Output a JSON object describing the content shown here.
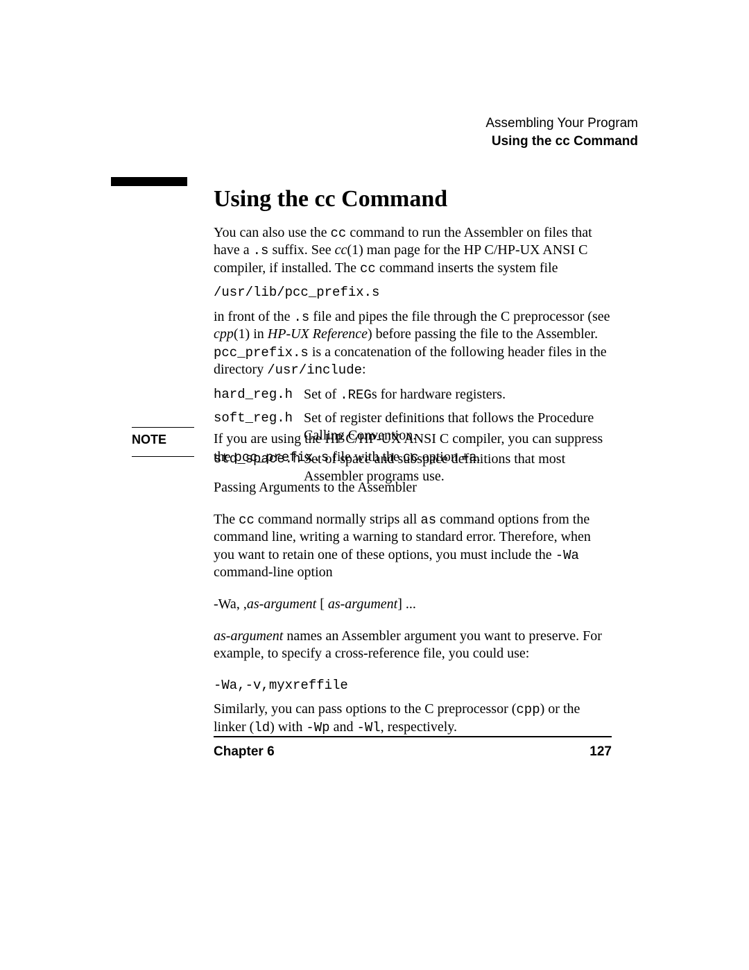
{
  "running_head": {
    "line1": "Assembling Your Program",
    "line2": "Using the cc Command"
  },
  "section": {
    "title": "Using the cc Command",
    "p1a": "You can also use the ",
    "p1b": "cc",
    "p1c": " command to run the Assembler on files that have a ",
    "p1d": ".s",
    "p1e": " suffix. See ",
    "p1f": "cc",
    "p1g": "(1) man page for the HP C/HP-UX ANSI C compiler, if installed. The ",
    "p1h": "cc",
    "p1i": " command inserts the system file",
    "codeline1": "/usr/lib/pcc_prefix.s",
    "p2a": "in front of the ",
    "p2b": ".s",
    "p2c": " file and pipes the file through the C preprocessor (see ",
    "p2d": "cpp",
    "p2e": "(1) in ",
    "p2f": "HP-UX Reference",
    "p2g": ") before passing the file to the Assembler. ",
    "p2h": "pcc_prefix.s",
    "p2i": " is a concatenation of the following header files in the directory ",
    "p2j": "/usr/include",
    "p2k": ":",
    "defs": [
      {
        "term": "hard_reg.h",
        "desc_a": "Set of ",
        "desc_b": ".REG",
        "desc_c": "s for hardware registers."
      },
      {
        "term": "soft_reg.h",
        "desc_a": "Set of register definitions that follows the Procedure Calling Convention.",
        "desc_b": "",
        "desc_c": ""
      },
      {
        "term": "std_space.h",
        "desc_a": "Set of space and subspace definitions that most Assembler programs use.",
        "desc_b": "",
        "desc_c": ""
      }
    ]
  },
  "note": {
    "label": "NOTE",
    "a": "If you are using the HP C/HP-UX ANSI C compiler, you can suppress the ",
    "b": "pcc_prefix.s",
    "c": " file with the ",
    "d": "cc",
    "e": " option ",
    "f": "+a",
    "g": "."
  },
  "subsection": {
    "title": "Passing Arguments to the Assembler",
    "p1a": "The ",
    "p1b": "cc",
    "p1c": " command normally strips all ",
    "p1d": "as",
    "p1e": " command options from the command line, writing a warning to standard error. Therefore, when you want to retain one of these options, you must include the ",
    "p1f": "-Wa",
    "p1g": " command-line option",
    "syntax_a": "-Wa,  ,",
    "syntax_b": "as-argument",
    "syntax_c": "  [  ",
    "syntax_d": "as-argument",
    "syntax_e": "]    ...",
    "p2a": "as-argument",
    "p2b": " names an Assembler argument you want to preserve. For example, to specify a cross-reference file, you could use:",
    "codeline2": "-Wa,-v,myxreffile",
    "p3a": "Similarly, you can pass options to the C preprocessor (",
    "p3b": "cpp",
    "p3c": ") or the linker (",
    "p3d": "ld",
    "p3e": ") with ",
    "p3f": "-Wp",
    "p3g": " and ",
    "p3h": "-Wl",
    "p3i": ", respectively."
  },
  "footer": {
    "chapter": "Chapter 6",
    "page": "127"
  }
}
